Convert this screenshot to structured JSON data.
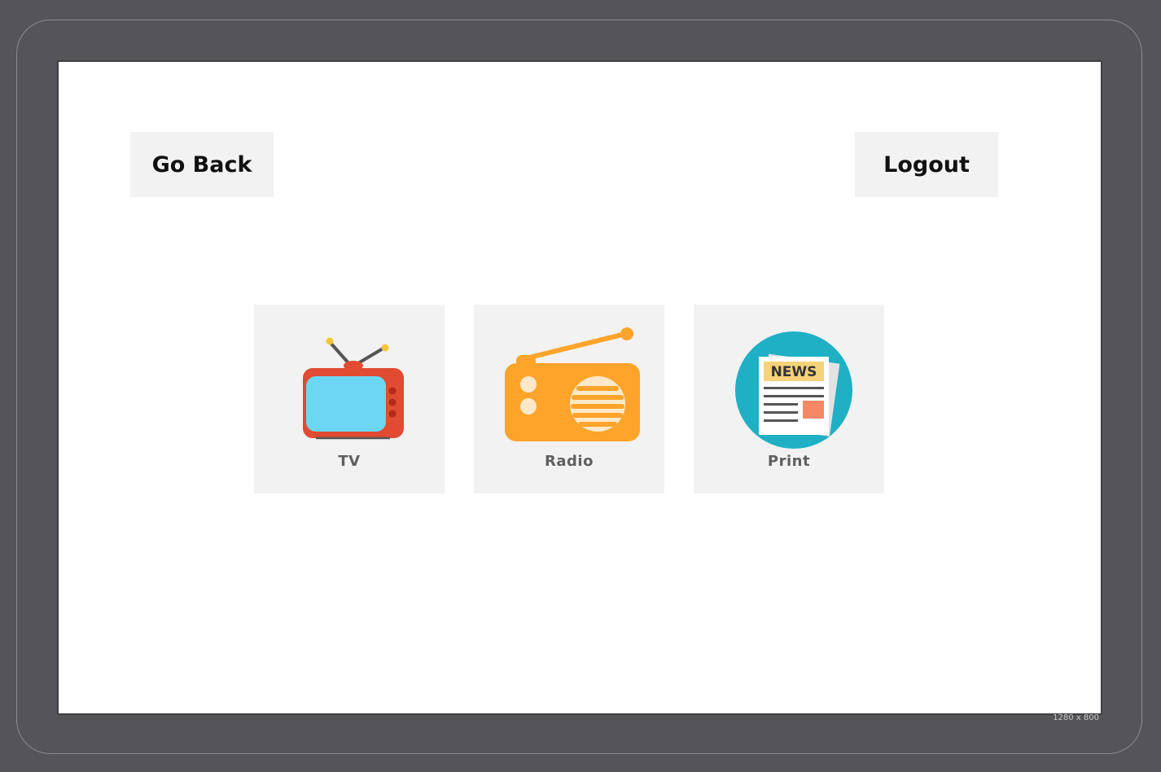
{
  "screen_size_label": "1280 x 800",
  "nav": {
    "back_label": "Go Back",
    "logout_label": "Logout"
  },
  "media": [
    {
      "label": "TV",
      "icon": "tv-icon"
    },
    {
      "label": "Radio",
      "icon": "radio-icon"
    },
    {
      "label": "Print",
      "icon": "newspaper-icon",
      "icon_text": "NEWS"
    }
  ],
  "colors": {
    "tile_background": "#f2f2f2",
    "tv_body": "#e04b32",
    "tv_screen": "#6dd6f4",
    "radio_body": "#ffa42a",
    "print_circle": "#1fb0c5"
  }
}
